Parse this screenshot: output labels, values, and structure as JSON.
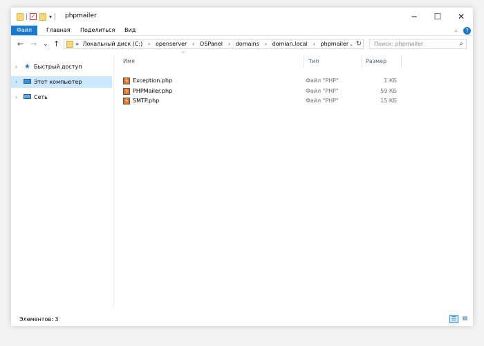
{
  "window": {
    "title": "phpmailer",
    "controls": {
      "minimize": "─",
      "maximize": "☐",
      "close": "✕"
    }
  },
  "ribbon": {
    "tabs": [
      "Файл",
      "Главная",
      "Поделиться",
      "Вид"
    ],
    "expand_icon": "chevron-down-icon",
    "help_icon": "?"
  },
  "nav": {
    "back": "←",
    "forward": "→",
    "recent": "⌄",
    "up": "↑",
    "address": {
      "overflow": "«",
      "segments": [
        "Локальный диск (C:)",
        "openserver",
        "OSPanel",
        "domains",
        "domian.local",
        "phpmailer"
      ]
    },
    "search": {
      "placeholder": "Поиск: phpmailer"
    }
  },
  "sidebar": {
    "items": [
      {
        "label": "Быстрый доступ",
        "icon": "star-icon",
        "selected": false
      },
      {
        "label": "Этот компьютер",
        "icon": "computer-icon",
        "selected": true
      },
      {
        "label": "Сеть",
        "icon": "network-icon",
        "selected": false
      }
    ]
  },
  "list": {
    "columns": {
      "name": "Имя",
      "type": "Тип",
      "size": "Размер"
    },
    "files": [
      {
        "name": "Exception.php",
        "type": "Файл \"PHP\"",
        "size": "1 КБ"
      },
      {
        "name": "PHPMailer.php",
        "type": "Файл \"PHP\"",
        "size": "59 КБ"
      },
      {
        "name": "SMTP.php",
        "type": "Файл \"PHP\"",
        "size": "15 КБ"
      }
    ]
  },
  "status": {
    "text": "Элементов: 3"
  },
  "colors": {
    "accent": "#1979ca",
    "selection": "#cce8ff",
    "folder": "#f8d775",
    "php": "#e8742a"
  }
}
